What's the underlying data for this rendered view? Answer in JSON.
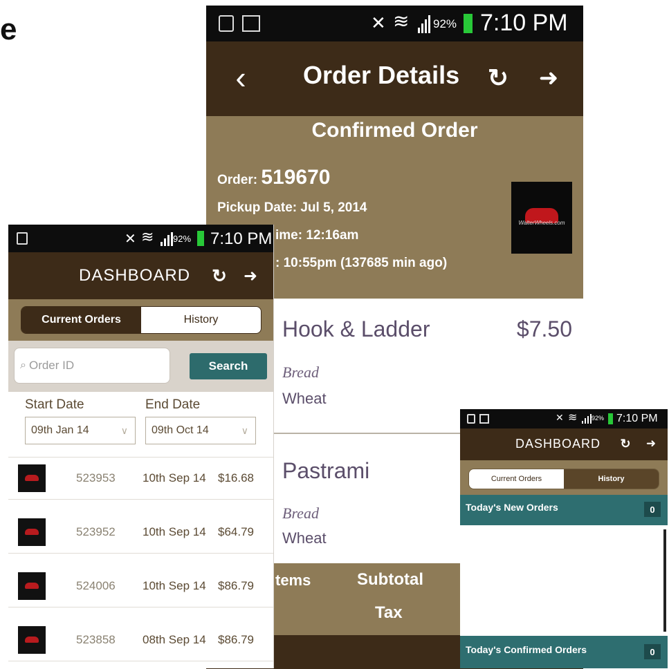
{
  "cut_label": "e",
  "order_screen": {
    "status": {
      "time": "7:10 PM",
      "battery": "92%"
    },
    "appbar": {
      "title": "Order Details"
    },
    "status_text": "Confirmed Order",
    "order_label": "Order:",
    "order_number": "519670",
    "pickup_date": "Pickup Date: Jul 5, 2014",
    "pickup_time_partial": "ime: 12:16am",
    "placed_partial": ": 10:55pm (137685 min ago)",
    "logo_text": "WalterWheels.com",
    "items": [
      {
        "name": "Hook & Ladder",
        "price": "$7.50",
        "sub_label": "Bread",
        "sub_value": "Wheat"
      },
      {
        "name": "Pastrami",
        "sub_label": "Bread",
        "sub_value": "Wheat"
      }
    ],
    "summary": {
      "items_partial": "tems",
      "subtotal": "Subtotal",
      "tax": "Tax"
    }
  },
  "dashboard_left": {
    "status": {
      "time": "7:10 PM",
      "battery": "92%"
    },
    "appbar": {
      "title": "DASHBOARD"
    },
    "tabs": [
      {
        "label": "Current Orders"
      },
      {
        "label": "History"
      }
    ],
    "search": {
      "placeholder": "Order ID",
      "button": "Search"
    },
    "start_date_label": "Start Date",
    "end_date_label": "End Date",
    "start_date_value": "09th Jan 14",
    "end_date_value": "09th Oct 14",
    "orders": [
      {
        "id": "523953",
        "date": "10th Sep 14",
        "amount": "$16.68"
      },
      {
        "id": "523952",
        "date": "10th Sep 14",
        "amount": "$64.79"
      },
      {
        "id": "524006",
        "date": "10th Sep 14",
        "amount": "$86.79"
      },
      {
        "id": "523858",
        "date": "08th Sep 14",
        "amount": "$86.79"
      }
    ]
  },
  "dashboard_right": {
    "status": {
      "time": "7:10 PM",
      "battery": "92%"
    },
    "appbar": {
      "title": "DASHBOARD"
    },
    "tabs": [
      {
        "label": "Current Orders"
      },
      {
        "label": "History"
      }
    ],
    "sections": [
      {
        "label": "Today's New Orders",
        "count": "0"
      },
      {
        "label": "Today's Confirmed Orders",
        "count": "0"
      }
    ]
  },
  "colors": {
    "dark_brown": "#3d2b18",
    "tan": "#8e7b57",
    "teal": "#2e6e70",
    "text_purple": "#5b4e6a"
  }
}
